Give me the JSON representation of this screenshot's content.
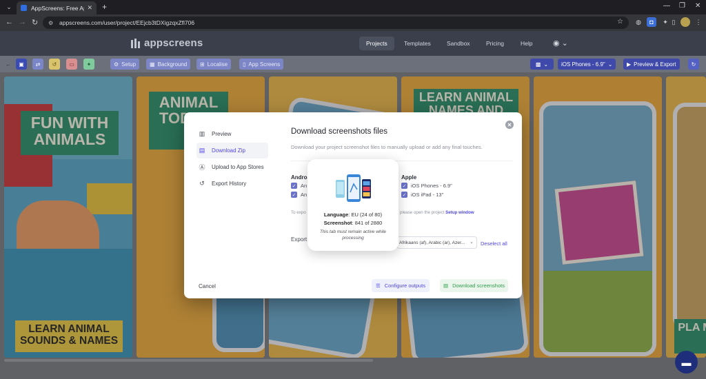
{
  "browser": {
    "tab_title": "AppScreens: Free App Store Sc",
    "url": "appscreens.com/user/project/EEjcb3tDXigzqxZfl706"
  },
  "app": {
    "logo_text": "appscreens",
    "nav": [
      {
        "label": "Projects",
        "active": true
      },
      {
        "label": "Templates",
        "active": false
      },
      {
        "label": "Sandbox",
        "active": false
      },
      {
        "label": "Pricing",
        "active": false
      },
      {
        "label": "Help",
        "active": false
      }
    ]
  },
  "toolbar": {
    "setup": "Setup",
    "background": "Background",
    "localise": "Localise",
    "app_screens": "App Screens",
    "device": "iOS Phones - 6.9\"",
    "preview_export": "Preview & Export"
  },
  "canvas": {
    "shot1_headline": "FUN WITH ANIMALS",
    "shot1_footer": "LEARN ANIMAL SOUNDS & NAMES",
    "shot2_headline": "ANIMAL TOD GA",
    "shot4_headline": "LEARN ANIMAL NAMES AND",
    "shot6_footer": "PLA M"
  },
  "modal": {
    "sidebar": [
      {
        "label": "Preview",
        "icon": "columns-icon",
        "active": false
      },
      {
        "label": "Download Zip",
        "icon": "zip-file-icon",
        "active": true
      },
      {
        "label": "Upload to App Stores",
        "icon": "app-store-icon",
        "active": false
      },
      {
        "label": "Export History",
        "icon": "history-icon",
        "active": false
      }
    ],
    "title": "Download screenshots files",
    "subtitle": "Download your project screenshot files to manually upload or add any final touches.",
    "android_heading": "Andro",
    "android_items": [
      "An",
      "An"
    ],
    "apple_heading": "Apple",
    "apple_items": [
      "iOS Phones - 6.9\"",
      "iOS iPad - 13\""
    ],
    "note_prefix": "To expo",
    "note_suffix": "please open the project",
    "note_link": "Setup window",
    "export_label": "Export",
    "languages_value": "Afrikaans (af), Arabic (ar), Azer...",
    "deselect_all": "Deselect all",
    "cancel": "Cancel",
    "configure_outputs": "Configure outputs",
    "download_screenshots": "Download screenshots"
  },
  "progress": {
    "language_label": "Language",
    "language_value": ": EU (24 of 80)",
    "screenshot_label": "Screenshot",
    "screenshot_value": ": 841 of 2880",
    "note": "This tab must remain active while processing"
  }
}
